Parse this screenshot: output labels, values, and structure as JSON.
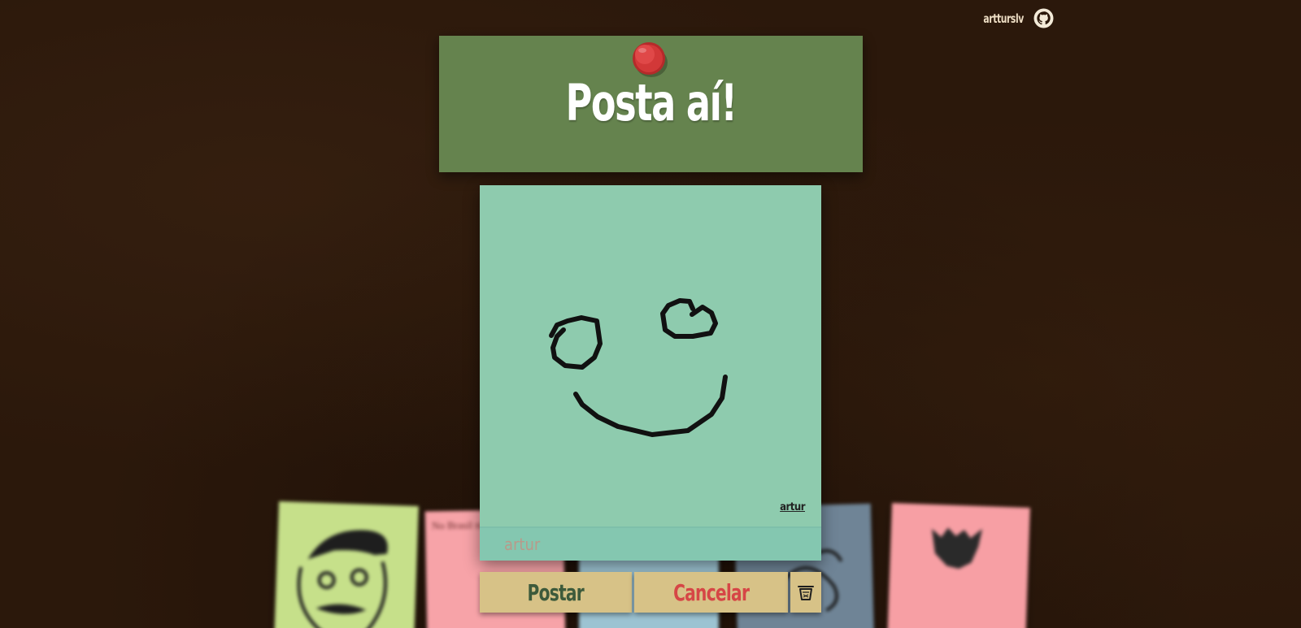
{
  "header": {
    "username": "artturslv",
    "github_icon": "github-icon"
  },
  "banner": {
    "title": "Posta aí!",
    "pin_icon": "pushpin-icon",
    "color": "#65834e"
  },
  "note": {
    "color": "#8ecbae",
    "author": "artur",
    "drawing": "smiley-face-sketch"
  },
  "name_input": {
    "value": "",
    "placeholder": "artur"
  },
  "actions": {
    "post_label": "Postar",
    "cancel_label": "Cancelar",
    "trash_icon": "trash-icon"
  },
  "background_notes": [
    {
      "color": "#c6e08a",
      "drawing": "mustache-face-sketch"
    },
    {
      "color": "#f7a3a8",
      "text": "No Brasil não"
    },
    {
      "color": "#9cc3d2"
    },
    {
      "color": "#6f8496",
      "drawing": "scribble-sketch"
    },
    {
      "color": "#f79fa4",
      "drawing": "beard-sketch"
    }
  ]
}
